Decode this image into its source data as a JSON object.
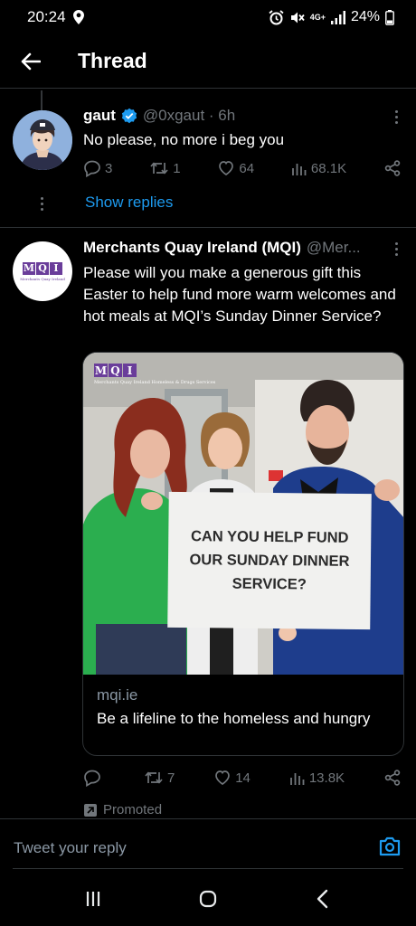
{
  "status_bar": {
    "time": "20:24",
    "network": "4G+",
    "battery": "24%",
    "icons": [
      "location-icon",
      "alarm-icon",
      "mute-icon",
      "signal-icon",
      "battery-icon"
    ]
  },
  "header": {
    "title": "Thread"
  },
  "tweet1": {
    "name": "gaut",
    "handle": "@0xgaut · 6h",
    "text": "No please, no more i beg you",
    "replies": "3",
    "retweets": "1",
    "likes": "64",
    "views": "68.1K",
    "show_replies": "Show replies"
  },
  "tweet2": {
    "name": "Merchants Quay Ireland (MQI)",
    "handle": "@Mer...",
    "text": "Please will you make a generous gift this Easter to help fund more warm welcomes and hot meals at MQI’s Sunday Dinner Service?",
    "avatar_logo": {
      "letters": [
        "M",
        "Q",
        "I"
      ],
      "subtitle": "Merchants Quay Ireland"
    },
    "card": {
      "domain": "mqi.ie",
      "title": "Be a lifeline to the homeless and hungry",
      "sign_text": "CAN YOU HELP FUND OUR SUNDAY DINNER SERVICE?",
      "photo_logo_subtitle": "Merchants Quay Ireland Homeless & Drugs Services"
    },
    "replies": "",
    "retweets": "7",
    "likes": "14",
    "views": "13.8K",
    "promoted": "Promoted"
  },
  "reply_bar": {
    "placeholder": "Tweet your reply"
  },
  "colors": {
    "background": "#000000",
    "accent": "#1d9bf0",
    "muted": "#71767b",
    "brand_purple": "#6a3d9a"
  }
}
